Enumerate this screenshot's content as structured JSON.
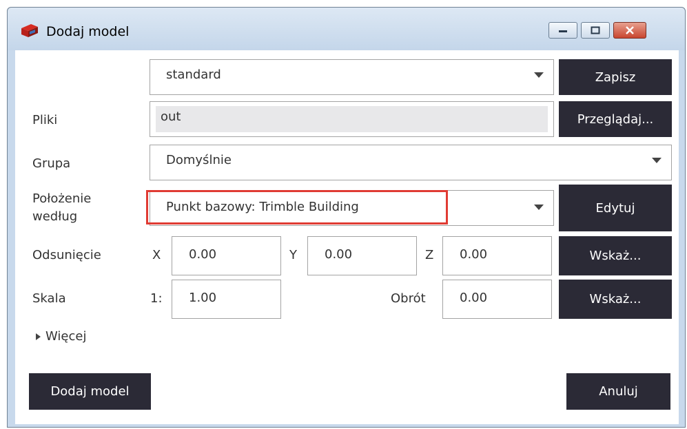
{
  "window": {
    "title": "Dodaj model",
    "controls": [
      "minimize",
      "maximize",
      "close"
    ]
  },
  "form": {
    "preset": {
      "value": "standard",
      "save_label": "Zapisz"
    },
    "files": {
      "label": "Pliki",
      "value": "out",
      "browse_label": "Przeglądaj..."
    },
    "group": {
      "label": "Grupa",
      "value": "Domyślnie"
    },
    "position": {
      "label_line1": "Położenie",
      "label_line2": "według",
      "value": "Punkt bazowy: Trimble Building",
      "edit_label": "Edytuj"
    },
    "offset": {
      "label": "Odsunięcie",
      "x_label": "X",
      "x": "0.00",
      "y_label": "Y",
      "y": "0.00",
      "z_label": "Z",
      "z": "0.00",
      "pick_label": "Wskaż..."
    },
    "scale": {
      "label": "Skala",
      "prefix": "1:",
      "value": "1.00",
      "rotation_label": "Obrót",
      "rotation": "0.00",
      "pick_label": "Wskaż..."
    },
    "more_label": "Więcej"
  },
  "footer": {
    "add_label": "Dodaj model",
    "cancel_label": "Anuluj"
  },
  "colors": {
    "button_dark": "#2b2a36",
    "highlight": "#e03b33",
    "titlebar": "#c8d9ec"
  }
}
